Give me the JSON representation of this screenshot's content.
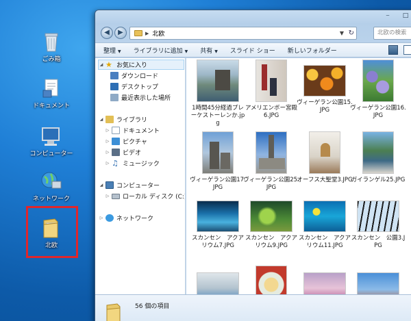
{
  "desktop": {
    "icons": [
      {
        "label": "ごみ箱",
        "icon": "recycle-bin-icon"
      },
      {
        "label": "ドキュメント",
        "icon": "documents-icon"
      },
      {
        "label": "コンピューター",
        "icon": "computer-icon"
      },
      {
        "label": "ネットワーク",
        "icon": "network-icon"
      },
      {
        "label": "北欧",
        "icon": "folder-icon"
      }
    ]
  },
  "window": {
    "address": {
      "path": "北欧"
    },
    "search": {
      "placeholder": "北欧の検索"
    },
    "toolbar": {
      "organize": "整理",
      "add_to_library": "ライブラリに追加",
      "share": "共有",
      "slideshow": "スライド ショー",
      "new_folder": "新しいフォルダー"
    },
    "nav": {
      "favorites": "お気に入り",
      "downloads": "ダウンロード",
      "desktop": "デスクトップ",
      "recent": "最近表示した場所",
      "libraries": "ライブラリ",
      "documents": "ドキュメント",
      "pictures": "ピクチャ",
      "videos": "ビデオ",
      "music": "ミュージック",
      "computer": "コンピューター",
      "local_disk": "ローカル ディスク (C:)",
      "network": "ネットワーク"
    },
    "files": [
      {
        "name": "1時間45分経過プレーケストーレンか.jpg"
      },
      {
        "name": "アメリエンボー宮殿6.JPG"
      },
      {
        "name": "ヴィーゲラン公園15.JPG"
      },
      {
        "name": "ヴィーゲラン公園16.JPG"
      },
      {
        "name": "ヴィーゲラン公園17.JPG"
      },
      {
        "name": "ヴィーゲラン公園25.JPG"
      },
      {
        "name": "オーフス大聖堂3.JPG"
      },
      {
        "name": "ガイランゲル25.JPG"
      },
      {
        "name": "スカンセン　アクアリウム7.JPG"
      },
      {
        "name": "スカンセン　アクアリウム9.JPG"
      },
      {
        "name": "スカンセン　アクアリウム11.JPG"
      },
      {
        "name": "スカンセン　公園3.JPG"
      },
      {
        "name": ""
      },
      {
        "name": ""
      },
      {
        "name": ""
      },
      {
        "name": ""
      }
    ],
    "status": {
      "count": "56 個の項目"
    }
  }
}
